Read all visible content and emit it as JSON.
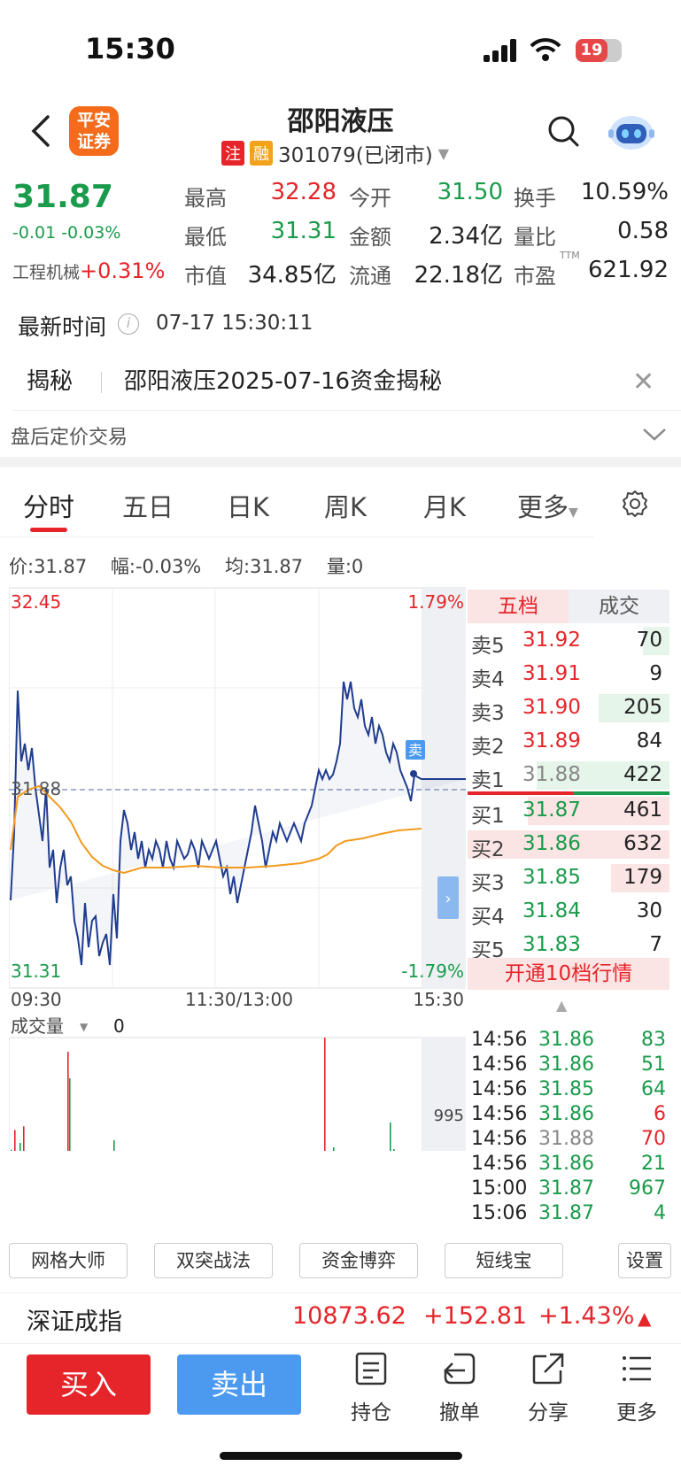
{
  "status_bar": {
    "time": "15:30",
    "battery": "19"
  },
  "header": {
    "logo_text_1": "平安",
    "logo_text_2": "证券",
    "stock_name": "邵阳液压",
    "tag_1": "注",
    "tag_2": "融",
    "code_status": "301079(已闭市)"
  },
  "quote": {
    "price": "31.87",
    "change": "-0.01 -0.03%",
    "sector_label": "工程机械",
    "sector_change": "+0.31%",
    "stats": [
      {
        "label": "最高",
        "value": "32.28"
      },
      {
        "label": "今开",
        "value": "31.50"
      },
      {
        "label": "换手",
        "value": "10.59%"
      },
      {
        "label": "最低",
        "value": "31.31"
      },
      {
        "label": "金额",
        "value": "2.34亿"
      },
      {
        "label": "量比",
        "value": "0.58"
      },
      {
        "label": "市值",
        "value": "34.85亿"
      },
      {
        "label": "流通",
        "value": "22.18亿"
      },
      {
        "label": "市盈",
        "value": "621.92"
      }
    ],
    "ttm": "TTM"
  },
  "latest": {
    "label": "最新时间",
    "time": "07-17 15:30:11"
  },
  "reveal": {
    "tag": "揭秘",
    "text": "邵阳液压2025-07-16资金揭秘"
  },
  "after_hours": "盘后定价交易",
  "tabs": [
    "分时",
    "五日",
    "日K",
    "周K",
    "月K",
    "更多"
  ],
  "price_line": {
    "price": "价:31.87",
    "amp": "幅:-0.03%",
    "avg": "均:31.87",
    "vol": "量:0"
  },
  "chart": {
    "top_price": "32.45",
    "bottom_price": "31.31",
    "top_pct": "1.79%",
    "bottom_pct": "-1.79%",
    "ref_price": "31.88",
    "time_start": "09:30",
    "time_mid": "11:30/13:00",
    "time_end": "15:30",
    "sell_marker": "卖",
    "volume_label": "成交量",
    "volume_value": "0",
    "volume_max": "995"
  },
  "orderbook": {
    "tab_active": "五档",
    "tab_other": "成交",
    "asks": [
      {
        "label": "卖5",
        "price": "31.92",
        "vol": "70"
      },
      {
        "label": "卖4",
        "price": "31.91",
        "vol": "9"
      },
      {
        "label": "卖3",
        "price": "31.90",
        "vol": "205"
      },
      {
        "label": "卖2",
        "price": "31.89",
        "vol": "84"
      },
      {
        "label": "卖1",
        "price": "31.88",
        "vol": "422"
      }
    ],
    "bids": [
      {
        "label": "买1",
        "price": "31.87",
        "vol": "461"
      },
      {
        "label": "买2",
        "price": "31.86",
        "vol": "632"
      },
      {
        "label": "买3",
        "price": "31.85",
        "vol": "179"
      },
      {
        "label": "买4",
        "price": "31.84",
        "vol": "30"
      },
      {
        "label": "买5",
        "price": "31.83",
        "vol": "7"
      }
    ],
    "open_10": "开通10档行情"
  },
  "trades": [
    {
      "time": "14:56",
      "price": "31.86",
      "vol": "83"
    },
    {
      "time": "14:56",
      "price": "31.86",
      "vol": "51"
    },
    {
      "time": "14:56",
      "price": "31.85",
      "vol": "64"
    },
    {
      "time": "14:56",
      "price": "31.86",
      "vol": "6"
    },
    {
      "time": "14:56",
      "price": "31.88",
      "vol": "70"
    },
    {
      "time": "14:56",
      "price": "31.86",
      "vol": "21"
    },
    {
      "time": "15:00",
      "price": "31.87",
      "vol": "967"
    },
    {
      "time": "15:06",
      "price": "31.87",
      "vol": "4"
    }
  ],
  "tools": [
    "网格大师",
    "双突战法",
    "资金博弈",
    "短线宝",
    "设置"
  ],
  "index": {
    "name": "深证成指",
    "value": "10873.62",
    "change": "+152.81",
    "pct": "+1.43%"
  },
  "bottom": {
    "buy": "买入",
    "sell": "卖出",
    "hold": "持仓",
    "cancel": "撤单",
    "share": "分享",
    "more": "更多"
  },
  "colors": {
    "up": "#e5252a",
    "down": "#1a9b4b",
    "accent": "#4b9af0",
    "price_line": "#1f3c8f",
    "avg_line": "#f39a1e"
  }
}
